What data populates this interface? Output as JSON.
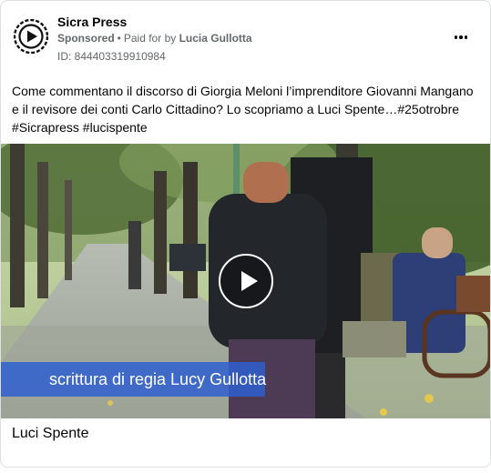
{
  "post": {
    "page_name": "Sicra Press",
    "sponsored": "Sponsored",
    "separator": "•",
    "paid_for_prefix": "Paid for by",
    "advertiser": "Lucia Gullotta",
    "ad_id": "ID: 844403319910984",
    "text": "Come commentano il discorso di Giorgia Meloni l’imprenditore Giovanni Mangano e il revisore dei conti Carlo Cittadino? Lo scopriamo a Luci Spente…#25otrobre #Sicrapress #lucispente",
    "more_icon": "more-horizontal-icon"
  },
  "media": {
    "overlay_text": "scrittura di regia Lucy Gullotta",
    "play_icon": "play-icon"
  },
  "link": {
    "title": "Luci Spente"
  },
  "colors": {
    "secondary_text": "#65676b",
    "overlay_band": "#2f5fd0"
  }
}
